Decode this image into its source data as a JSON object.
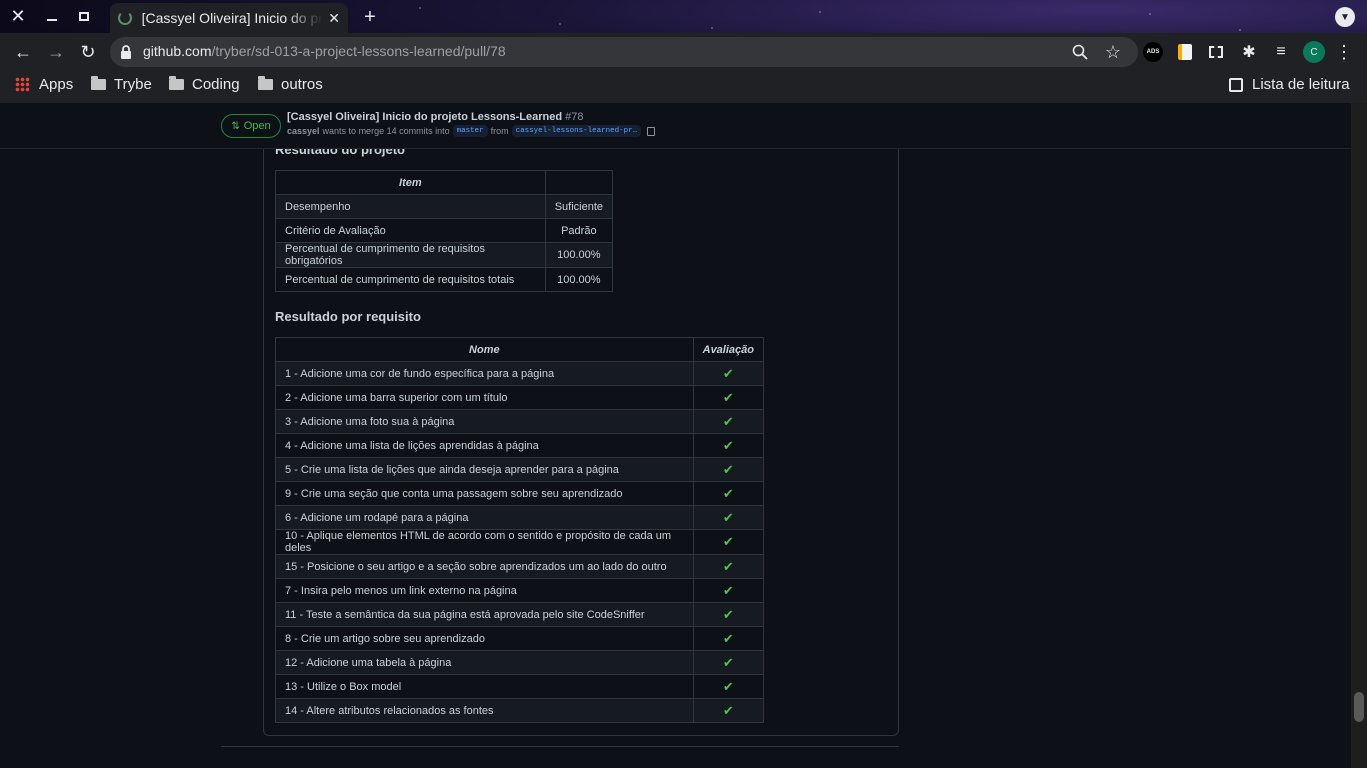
{
  "browser": {
    "tab_title": "[Cassyel Oliveira] Inicio do projeto Lessons-Learned",
    "url_host": "github.com",
    "url_path": "/tryber/sd-013-a-project-lessons-learned/pull/78",
    "profile_initial": "C",
    "ext_label": "ADS",
    "bookmarks": [
      "Apps",
      "Trybe",
      "Coding",
      "outros"
    ],
    "reading_list": "Lista de leitura"
  },
  "pr": {
    "state": "Open",
    "title": "[Cassyel Oliveira] Inicio do projeto Lessons-Learned",
    "number": "#78",
    "author": "cassyel",
    "merge_text": "wants to merge 14 commits into",
    "base_branch": "master",
    "from_text": "from",
    "head_branch": "cassyel-lessons-learned-pr…"
  },
  "results": {
    "heading": "Resultado do projeto",
    "columns": [
      "Item",
      ""
    ],
    "rows": [
      [
        "Desempenho",
        "Suficiente"
      ],
      [
        "Critério de Avaliação",
        "Padrão"
      ],
      [
        "Percentual de cumprimento de requisitos obrigatórios",
        "100.00%"
      ],
      [
        "Percentual de cumprimento de requisitos totais",
        "100.00%"
      ]
    ]
  },
  "requirements": {
    "heading": "Resultado por requisito",
    "columns": [
      "Nome",
      "Avaliação"
    ],
    "check": "✔",
    "rows": [
      "1 - Adicione uma cor de fundo específica para a página",
      "2 - Adicione uma barra superior com um título",
      "3 - Adicione uma foto sua à página",
      "4 - Adicione uma lista de lições aprendidas à página",
      "5 - Crie uma lista de lições que ainda deseja aprender para a página",
      "9 - Crie uma seção que conta uma passagem sobre seu aprendizado",
      "6 - Adicione um rodapé para a página",
      "10 - Aplique elementos HTML de acordo com o sentido e propósito de cada um deles",
      "15 - Posicione o seu artigo e a seção sobre aprendizados um ao lado do outro",
      "7 - Insira pelo menos um link externo na página",
      "11 - Teste a semântica da sua página está aprovada pelo site CodeSniffer",
      "8 - Crie um artigo sobre seu aprendizado",
      "12 - Adicione uma tabela à página",
      "13 - Utilize o Box model",
      "14 - Altere atributos relacionados as fontes"
    ]
  },
  "colors": {
    "open_green": "#3fb950",
    "check_green": "#5cb85c",
    "page_bg": "#0d1117"
  }
}
